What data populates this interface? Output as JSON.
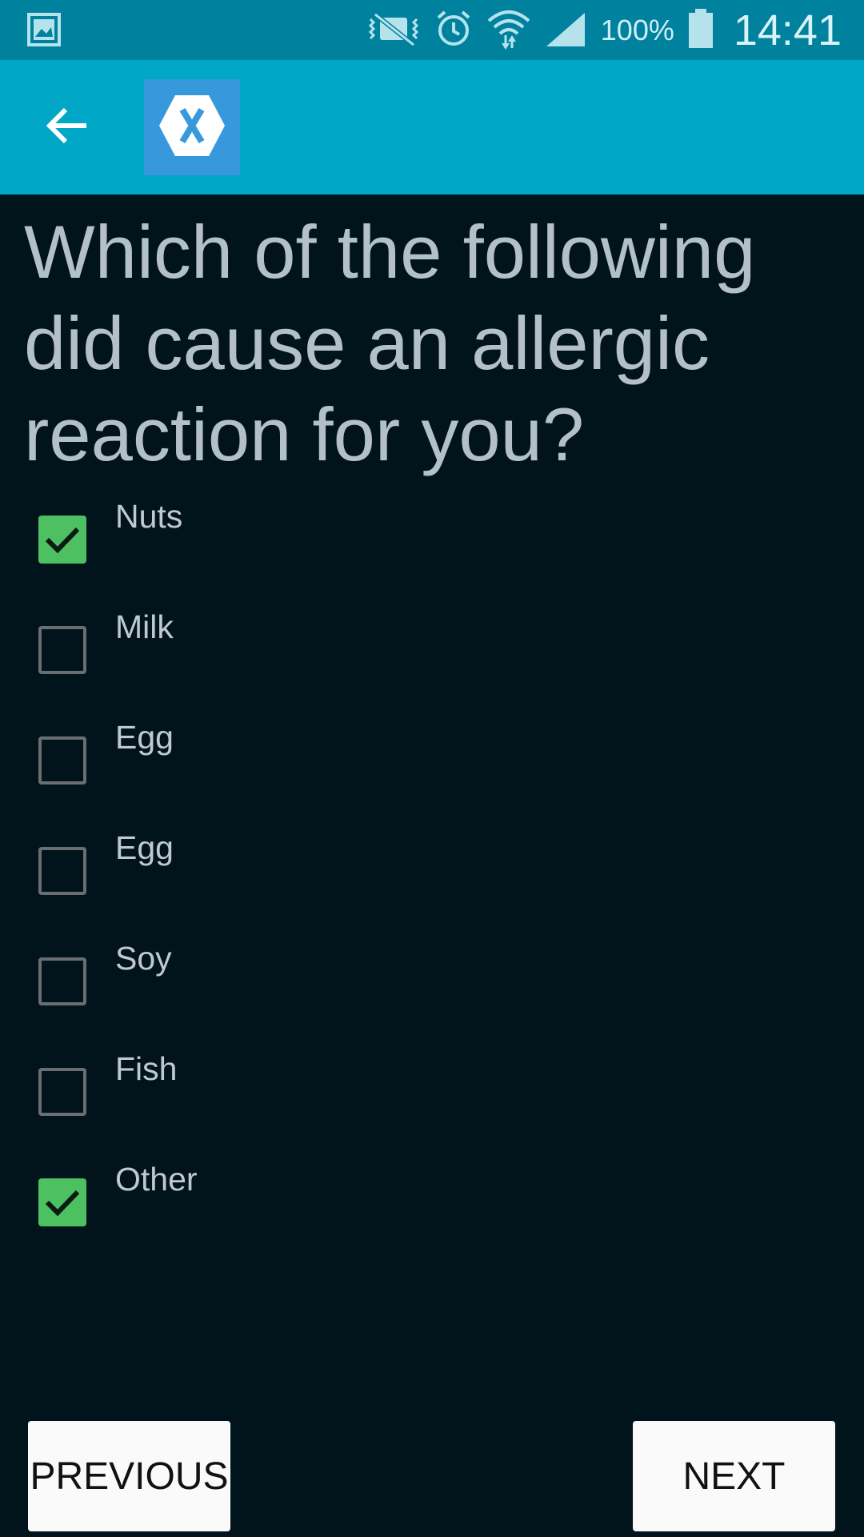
{
  "status_bar": {
    "icons": [
      "gallery-icon",
      "vibrate-mute-icon",
      "alarm-icon",
      "wifi-icon",
      "signal-icon",
      "battery-icon"
    ],
    "battery_percent": "100%",
    "time": "14:41"
  },
  "app_bar": {
    "back_icon": "arrow-left-icon",
    "logo_icon": "xamarin-logo-icon",
    "colors": {
      "background": "#00a7c6",
      "logo_bg": "#3898dc"
    }
  },
  "question": {
    "text": "Which of the following did cause an allergic reaction for you?"
  },
  "options": [
    {
      "label": "Nuts",
      "checked": true
    },
    {
      "label": "Milk",
      "checked": false
    },
    {
      "label": "Egg",
      "checked": false
    },
    {
      "label": "Egg",
      "checked": false
    },
    {
      "label": "Soy",
      "checked": false
    },
    {
      "label": "Fish",
      "checked": false
    },
    {
      "label": "Other",
      "checked": true
    }
  ],
  "navigation": {
    "previous_label": "PREVIOUS",
    "next_label": "NEXT"
  },
  "colors": {
    "background": "#01141b",
    "status_bar": "#00829f",
    "checkbox_checked": "#4dc162",
    "checkbox_unchecked_border": "#6b6e70",
    "question_text": "#b4c0c9"
  }
}
